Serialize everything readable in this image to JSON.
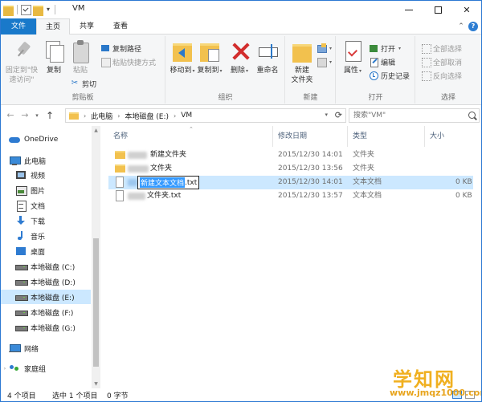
{
  "window": {
    "title": "VM",
    "minimize_symbol": "—",
    "maximize_symbol": "☐",
    "close_symbol": "✕"
  },
  "ribbon_tabs": {
    "file": "文件",
    "home": "主页",
    "share": "共享",
    "view": "查看",
    "help": "?"
  },
  "clipboard": {
    "group_label": "剪贴板",
    "pin": "固定到\"快\n速访问\"",
    "copy": "复制",
    "paste": "粘贴",
    "copy_path": "复制路径",
    "paste_shortcut": "粘贴快捷方式",
    "cut": "剪切"
  },
  "organize": {
    "group_label": "组织",
    "move_to": "移动到",
    "copy_to": "复制到",
    "delete": "删除",
    "rename": "重命名"
  },
  "new": {
    "group_label": "新建",
    "new_folder": "新建\n文件夹"
  },
  "open": {
    "group_label": "打开",
    "properties": "属性",
    "open": "打开",
    "edit": "编辑",
    "history": "历史记录"
  },
  "select": {
    "group_label": "选择",
    "select_all": "全部选择",
    "select_none": "全部取消",
    "invert": "反向选择"
  },
  "address": {
    "crumbs": [
      "此电脑",
      "本地磁盘 (E:)",
      "VM"
    ],
    "search_placeholder": "搜索\"VM\""
  },
  "nav": {
    "items": [
      {
        "label": "OneDrive",
        "icon": "cloud-icon"
      },
      {
        "label": "此电脑",
        "icon": "computer-icon"
      },
      {
        "label": "视频",
        "icon": "video-icon"
      },
      {
        "label": "图片",
        "icon": "pictures-icon"
      },
      {
        "label": "文档",
        "icon": "documents-icon"
      },
      {
        "label": "下载",
        "icon": "download-icon"
      },
      {
        "label": "音乐",
        "icon": "music-icon"
      },
      {
        "label": "桌面",
        "icon": "desktop-icon"
      },
      {
        "label": "本地磁盘 (C:)",
        "icon": "drive-icon"
      },
      {
        "label": "本地磁盘 (D:)",
        "icon": "drive-icon"
      },
      {
        "label": "本地磁盘 (E:)",
        "icon": "drive-icon"
      },
      {
        "label": "本地磁盘 (F:)",
        "icon": "drive-icon"
      },
      {
        "label": "本地磁盘 (G:)",
        "icon": "drive-icon"
      },
      {
        "label": "网络",
        "icon": "network-icon"
      },
      {
        "label": "家庭组",
        "icon": "homegroup-icon"
      }
    ]
  },
  "columns": {
    "name": "名称",
    "modified": "修改日期",
    "type": "类型",
    "size": "大小"
  },
  "files": [
    {
      "name": "新建文件夹",
      "modified": "2015/12/30 14:01",
      "type": "文件夹",
      "size": "",
      "kind": "folder"
    },
    {
      "name": "文件夹",
      "modified": "2015/12/30 13:56",
      "type": "文件夹",
      "size": "",
      "kind": "folder"
    },
    {
      "name_highlight": "新建文本文档",
      "name_rest": ".txt",
      "modified": "2015/12/30 14:01",
      "type": "文本文档",
      "size": "0 KB",
      "kind": "txt"
    },
    {
      "name": "文件夹.txt",
      "modified": "2015/12/30 13:57",
      "type": "文本文档",
      "size": "0 KB",
      "kind": "txt"
    }
  ],
  "status": {
    "count": "4 个项目",
    "selected": "选中 1 个项目",
    "size": "0 字节"
  },
  "watermark": {
    "brand": "学知网",
    "url": "www.jmqz1000.com"
  }
}
